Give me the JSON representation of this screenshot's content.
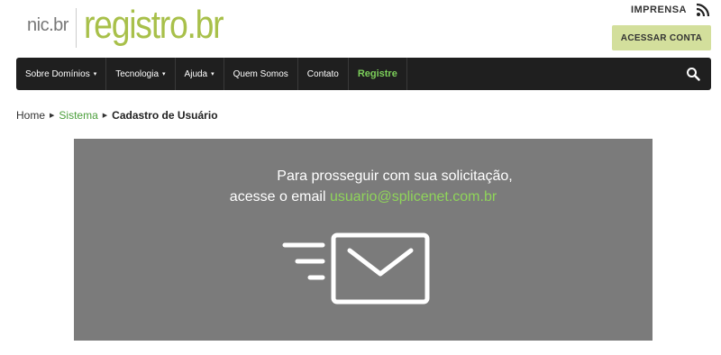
{
  "header": {
    "logo_nic": "nic.br",
    "logo_main": "registro.br",
    "imprensa_label": "IMPRENSA",
    "acessar_label": "ACESSAR CONTA"
  },
  "nav": {
    "items": [
      {
        "label": "Sobre Domínios",
        "dropdown": true
      },
      {
        "label": "Tecnologia",
        "dropdown": true
      },
      {
        "label": "Ajuda",
        "dropdown": true
      },
      {
        "label": "Quem Somos",
        "dropdown": false
      },
      {
        "label": "Contato",
        "dropdown": false
      },
      {
        "label": "Registre",
        "dropdown": false
      }
    ],
    "caret": "▾"
  },
  "breadcrumb": {
    "home": "Home",
    "sistema": "Sistema",
    "current": "Cadastro de Usuário"
  },
  "panel": {
    "line1": "Para prosseguir com sua solicitação,",
    "line2_prefix": "acesse o email",
    "email": "usuario@splicenet.com.br"
  },
  "colors": {
    "brand_green": "#a8c04a",
    "accent_green": "#7ccf5a",
    "nav_bg": "#1f1f1f",
    "panel_bg": "#7b7b7b",
    "button_bg": "#d3df9c"
  },
  "icons": [
    "rss-icon",
    "search-icon",
    "email-sent-icon"
  ]
}
